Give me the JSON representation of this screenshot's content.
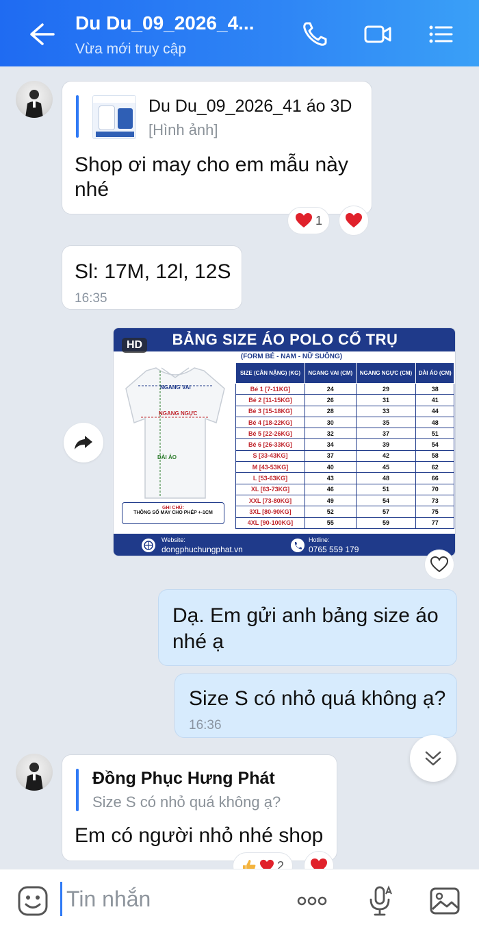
{
  "header": {
    "title": "Du Du_09_2026_4...",
    "subtitle": "Vừa mới truy cập"
  },
  "messages": {
    "m1": {
      "quote_title": "Du Du_09_2026_41 áo 3D",
      "quote_sub": "[Hình ảnh]",
      "line1": "Shop ơi may cho em mẫu này",
      "line2": "nhé",
      "reaction_count": "1"
    },
    "m2": {
      "text": "Sl: 17M, 12l, 12S",
      "time": "16:35"
    },
    "m3": {
      "line1": "Dạ. Em gửi anh bảng size áo",
      "line2": "nhé ạ"
    },
    "m4": {
      "text": "Size S có nhỏ quá không ạ?",
      "time": "16:36"
    },
    "m5": {
      "quote_title": "Đồng Phục Hưng Phát",
      "quote_sub": "Size S có nhỏ quá không ạ?",
      "text": "Em có người nhỏ nhé shop",
      "reaction_count": "2"
    }
  },
  "size_chart": {
    "hd": "HD",
    "title": "BẢNG SIZE ÁO POLO CỔ TRỤ",
    "form": "(FORM BÉ - NAM - NỮ SUÔNG)",
    "headers": [
      "SIZE (CÂN NẶNG) (KG)",
      "NGANG VAI (CM)",
      "NGANG NGỰC (CM)",
      "DÀI ÁO (CM)"
    ],
    "rows": [
      [
        "Bé 1 [7-11KG]",
        "24",
        "29",
        "38"
      ],
      [
        "Bé 2 [11-15KG]",
        "26",
        "31",
        "41"
      ],
      [
        "Bé 3 [15-18KG]",
        "28",
        "33",
        "44"
      ],
      [
        "Bé 4 [18-22KG]",
        "30",
        "35",
        "48"
      ],
      [
        "Bé 5 [22-26KG]",
        "32",
        "37",
        "51"
      ],
      [
        "Bé 6 [26-33KG]",
        "34",
        "39",
        "54"
      ],
      [
        "S [33-43KG]",
        "37",
        "42",
        "58"
      ],
      [
        "M [43-53KG]",
        "40",
        "45",
        "62"
      ],
      [
        "L [53-63KG]",
        "43",
        "48",
        "66"
      ],
      [
        "XL [63-73KG]",
        "46",
        "51",
        "70"
      ],
      [
        "XXL [73-80KG]",
        "49",
        "54",
        "73"
      ],
      [
        "3XL [80-90KG]",
        "52",
        "57",
        "75"
      ],
      [
        "4XL [90-100KG]",
        "55",
        "59",
        "77"
      ]
    ],
    "labels": {
      "shoulder": "NGANG VAI",
      "chest": "NGANG NGỰC",
      "length": "DÀI ÁO"
    },
    "note_title": "GHI CHÚ:",
    "note_text": "THÔNG SỐ MAY CHO PHÉP +-1CM",
    "website_label": "Website:",
    "website": "dongphuchungphat.vn",
    "hotline_label": "Hotline:",
    "hotline": "0765 559 179"
  },
  "composer": {
    "placeholder": "Tin nhắn"
  },
  "colors": {
    "header_start": "#1f6bf2",
    "header_end": "#3aa0f7",
    "my_bubble": "#d7ebfd",
    "accent": "#2f7af5"
  }
}
